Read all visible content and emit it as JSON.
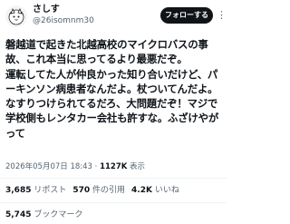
{
  "user": {
    "display_name": "さしす",
    "handle": "@26isomnm30"
  },
  "follow_button": {
    "label": "フォローする"
  },
  "tweet": {
    "text": "磐越道で起きた北越高校のマイクロバスの事故、これ本当に思ってるより最悪だぞ。\n運転してた人が仲良かった知り合いだけど、パーキンソン病患者なんだよ。杖ついてんだよ。なすりつけられてるだろ、大問題だぞ！マジで学校側もレンタカー会社も許すな。ふざけやがって"
  },
  "meta": {
    "date": "2026年05月07日 18:43",
    "separator": "·",
    "views_count": "1127K",
    "views_label": "表示"
  },
  "stats": {
    "retweets_count": "3,685",
    "retweets_label": "リポスト",
    "quotes_count": "570",
    "quotes_label": "件の引用",
    "likes_count": "4.2K",
    "likes_label": "いいね",
    "bookmarks_count": "5,745",
    "bookmarks_label": "ブックマーク"
  },
  "icons": {
    "more": "more-options-icon",
    "avatar": "avatar-image"
  },
  "colors": {
    "text": "#0f1419",
    "secondary": "#536471",
    "button_bg": "#0f1419",
    "divider": "#eff3f4"
  }
}
